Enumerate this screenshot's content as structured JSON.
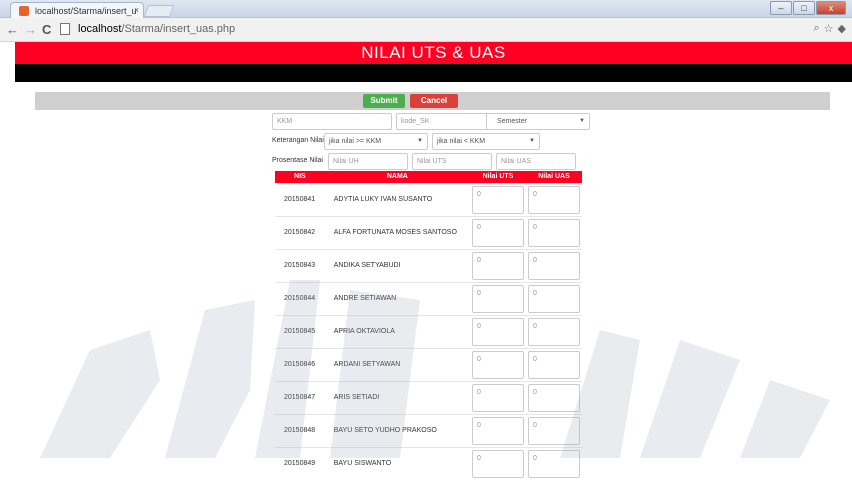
{
  "browser": {
    "tab_title": "localhost/Starma/insert_u",
    "tab_close": "×",
    "url_host": "localhost",
    "url_path": "/Starma/insert_uas.php",
    "back": "←",
    "forward": "→",
    "reload": "C",
    "win_min": "–",
    "win_max": "□",
    "win_close": "x",
    "zoom_icon": "⌕",
    "star_icon": "☆",
    "ext_icon": "◆"
  },
  "header": {
    "title": "NILAI UTS & UAS"
  },
  "actions": {
    "submit": "Submit",
    "cancel": "Cancel"
  },
  "form": {
    "kkm_placeholder": "KKM",
    "kode_sk_placeholder": "kode_SK",
    "semester_value": "Semester",
    "keterangan_label": "Keterangan Nilai",
    "ket1_value": "jika nilai >= KKM",
    "ket2_value": "jika nilai < KKM",
    "prosentase_label": "Prosentase Nilai",
    "uh_placeholder": "Nilai UH",
    "uts_placeholder": "Nilai UTS",
    "uas_placeholder": "Nilai UAS"
  },
  "table": {
    "headers": [
      "NIS",
      "NAMA",
      "Nilai UTS",
      "Nilai UAS"
    ],
    "rows": [
      {
        "nis": "20150841",
        "nama": "ADYTIA LUKY IVAN SUSANTO",
        "uts": "0",
        "uas": "0"
      },
      {
        "nis": "20150842",
        "nama": "ALFA FORTUNATA MOSES SANTOSO",
        "uts": "0",
        "uas": "0"
      },
      {
        "nis": "20150843",
        "nama": "ANDIKA SETYABUDI",
        "uts": "0",
        "uas": "0"
      },
      {
        "nis": "20150844",
        "nama": "ANDRE SETIAWAN",
        "uts": "0",
        "uas": "0"
      },
      {
        "nis": "20150845",
        "nama": "APRIA OKTAVIOLA",
        "uts": "0",
        "uas": "0"
      },
      {
        "nis": "20150846",
        "nama": "ARDANI SETYAWAN",
        "uts": "0",
        "uas": "0"
      },
      {
        "nis": "20150847",
        "nama": "ARIS SETIADI",
        "uts": "0",
        "uas": "0"
      },
      {
        "nis": "20150848",
        "nama": "BAYU SETO YUDHO PRAKOSO",
        "uts": "0",
        "uas": "0"
      },
      {
        "nis": "20150849",
        "nama": "BAYU SISWANTO",
        "uts": "0",
        "uas": "0"
      }
    ]
  },
  "colors": {
    "accent_red": "#ff0022",
    "submit_green": "#4cae4c",
    "cancel_red": "#d9413a"
  }
}
